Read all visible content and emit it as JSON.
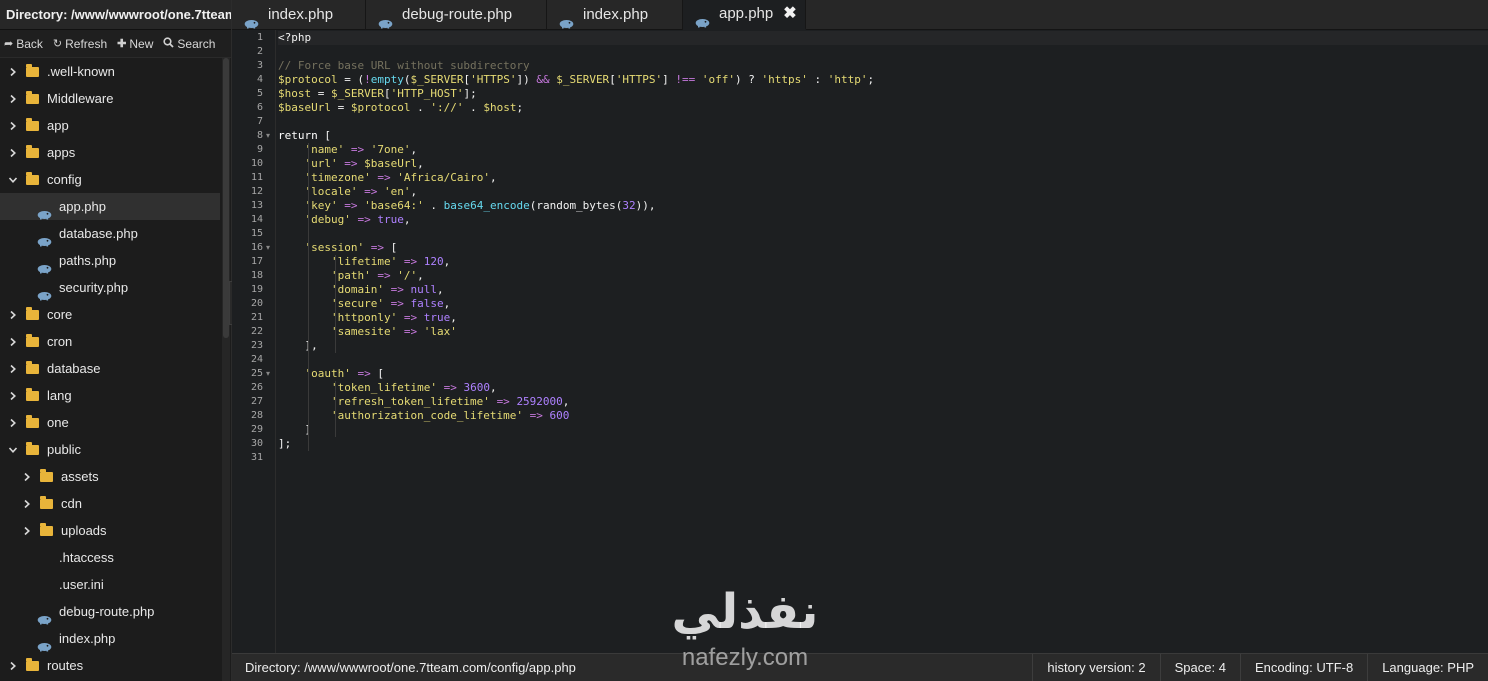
{
  "sidebar": {
    "title": "Directory: /www/wwwroot/one.7tteam....",
    "toolbar": {
      "back": "Back",
      "refresh": "Refresh",
      "new": "New",
      "search": "Search"
    },
    "tree": [
      {
        "label": ".well-known",
        "type": "folder",
        "depth": 0,
        "expanded": false
      },
      {
        "label": "Middleware",
        "type": "folder",
        "depth": 0,
        "expanded": false
      },
      {
        "label": "app",
        "type": "folder",
        "depth": 0,
        "expanded": false
      },
      {
        "label": "apps",
        "type": "folder",
        "depth": 0,
        "expanded": false
      },
      {
        "label": "config",
        "type": "folder",
        "depth": 0,
        "expanded": true
      },
      {
        "label": "app.php",
        "type": "php",
        "depth": 1,
        "selected": true
      },
      {
        "label": "database.php",
        "type": "php",
        "depth": 1
      },
      {
        "label": "paths.php",
        "type": "php",
        "depth": 1
      },
      {
        "label": "security.php",
        "type": "php",
        "depth": 1
      },
      {
        "label": "core",
        "type": "folder",
        "depth": 0,
        "expanded": false
      },
      {
        "label": "cron",
        "type": "folder",
        "depth": 0,
        "expanded": false
      },
      {
        "label": "database",
        "type": "folder",
        "depth": 0,
        "expanded": false
      },
      {
        "label": "lang",
        "type": "folder",
        "depth": 0,
        "expanded": false
      },
      {
        "label": "one",
        "type": "folder",
        "depth": 0,
        "expanded": false
      },
      {
        "label": "public",
        "type": "folder",
        "depth": 0,
        "expanded": true
      },
      {
        "label": "assets",
        "type": "folder",
        "depth": 1,
        "expanded": false
      },
      {
        "label": "cdn",
        "type": "folder",
        "depth": 1,
        "expanded": false
      },
      {
        "label": "uploads",
        "type": "folder",
        "depth": 1,
        "expanded": false
      },
      {
        "label": ".htaccess",
        "type": "file",
        "depth": 1
      },
      {
        "label": ".user.ini",
        "type": "file",
        "depth": 1
      },
      {
        "label": "debug-route.php",
        "type": "php",
        "depth": 1
      },
      {
        "label": "index.php",
        "type": "php",
        "depth": 1
      },
      {
        "label": "routes",
        "type": "folder",
        "depth": 0,
        "expanded": false
      }
    ]
  },
  "tabs": [
    {
      "label": "index.php",
      "active": false
    },
    {
      "label": "debug-route.php",
      "active": false
    },
    {
      "label": "index.php",
      "active": false
    },
    {
      "label": "app.php",
      "active": true,
      "close": "✖"
    }
  ],
  "editor": {
    "lines": [
      [
        [
          "p",
          "<?php"
        ]
      ],
      [],
      [
        [
          "cmt",
          "// Force base URL without subdirectory"
        ]
      ],
      [
        [
          "var",
          "$protocol"
        ],
        [
          "p",
          " = ("
        ],
        [
          "op",
          "!"
        ],
        [
          "fn",
          "empty"
        ],
        [
          "p",
          "("
        ],
        [
          "var",
          "$_SERVER"
        ],
        [
          "p",
          "["
        ],
        [
          "str",
          "'HTTPS'"
        ],
        [
          "p",
          "]) "
        ],
        [
          "op",
          "&&"
        ],
        [
          "p",
          " "
        ],
        [
          "var",
          "$_SERVER"
        ],
        [
          "p",
          "["
        ],
        [
          "str",
          "'HTTPS'"
        ],
        [
          "p",
          "] "
        ],
        [
          "op",
          "!=="
        ],
        [
          "p",
          " "
        ],
        [
          "str",
          "'off'"
        ],
        [
          "p",
          ") ? "
        ],
        [
          "str",
          "'https'"
        ],
        [
          "p",
          " : "
        ],
        [
          "str",
          "'http'"
        ],
        [
          "p",
          ";"
        ]
      ],
      [
        [
          "var",
          "$host"
        ],
        [
          "p",
          " = "
        ],
        [
          "var",
          "$_SERVER"
        ],
        [
          "p",
          "["
        ],
        [
          "str",
          "'HTTP_HOST'"
        ],
        [
          "p",
          "];"
        ]
      ],
      [
        [
          "var",
          "$baseUrl"
        ],
        [
          "p",
          " = "
        ],
        [
          "var",
          "$protocol"
        ],
        [
          "p",
          " . "
        ],
        [
          "str",
          "'://'"
        ],
        [
          "p",
          " . "
        ],
        [
          "var",
          "$host"
        ],
        [
          "p",
          ";"
        ]
      ],
      [],
      [
        [
          "kw",
          "return"
        ],
        [
          "p",
          " ["
        ]
      ],
      [
        [
          "p",
          "    "
        ],
        [
          "str",
          "'name'"
        ],
        [
          "p",
          " "
        ],
        [
          "op",
          "=>"
        ],
        [
          "p",
          " "
        ],
        [
          "str",
          "'7one'"
        ],
        [
          "p",
          ","
        ]
      ],
      [
        [
          "p",
          "    "
        ],
        [
          "str",
          "'url'"
        ],
        [
          "p",
          " "
        ],
        [
          "op",
          "=>"
        ],
        [
          "p",
          " "
        ],
        [
          "var",
          "$baseUrl"
        ],
        [
          "p",
          ","
        ]
      ],
      [
        [
          "p",
          "    "
        ],
        [
          "str",
          "'timezone'"
        ],
        [
          "p",
          " "
        ],
        [
          "op",
          "=>"
        ],
        [
          "p",
          " "
        ],
        [
          "str",
          "'Africa/Cairo'"
        ],
        [
          "p",
          ","
        ]
      ],
      [
        [
          "p",
          "    "
        ],
        [
          "str",
          "'locale'"
        ],
        [
          "p",
          " "
        ],
        [
          "op",
          "=>"
        ],
        [
          "p",
          " "
        ],
        [
          "str",
          "'en'"
        ],
        [
          "p",
          ","
        ]
      ],
      [
        [
          "p",
          "    "
        ],
        [
          "str",
          "'key'"
        ],
        [
          "p",
          " "
        ],
        [
          "op",
          "=>"
        ],
        [
          "p",
          " "
        ],
        [
          "str",
          "'base64:'"
        ],
        [
          "p",
          " . "
        ],
        [
          "fn",
          "base64_encode"
        ],
        [
          "p",
          "(random_bytes("
        ],
        [
          "num",
          "32"
        ],
        [
          "p",
          ")),"
        ]
      ],
      [
        [
          "p",
          "    "
        ],
        [
          "str",
          "'debug'"
        ],
        [
          "p",
          " "
        ],
        [
          "op",
          "=>"
        ],
        [
          "p",
          " "
        ],
        [
          "bool",
          "true"
        ],
        [
          "p",
          ","
        ]
      ],
      [],
      [
        [
          "p",
          "    "
        ],
        [
          "str",
          "'session'"
        ],
        [
          "p",
          " "
        ],
        [
          "op",
          "=>"
        ],
        [
          "p",
          " ["
        ]
      ],
      [
        [
          "p",
          "        "
        ],
        [
          "str",
          "'lifetime'"
        ],
        [
          "p",
          " "
        ],
        [
          "op",
          "=>"
        ],
        [
          "p",
          " "
        ],
        [
          "num",
          "120"
        ],
        [
          "p",
          ","
        ]
      ],
      [
        [
          "p",
          "        "
        ],
        [
          "str",
          "'path'"
        ],
        [
          "p",
          " "
        ],
        [
          "op",
          "=>"
        ],
        [
          "p",
          " "
        ],
        [
          "str",
          "'/'"
        ],
        [
          "p",
          ","
        ]
      ],
      [
        [
          "p",
          "        "
        ],
        [
          "str",
          "'domain'"
        ],
        [
          "p",
          " "
        ],
        [
          "op",
          "=>"
        ],
        [
          "p",
          " "
        ],
        [
          "bool",
          "null"
        ],
        [
          "p",
          ","
        ]
      ],
      [
        [
          "p",
          "        "
        ],
        [
          "str",
          "'secure'"
        ],
        [
          "p",
          " "
        ],
        [
          "op",
          "=>"
        ],
        [
          "p",
          " "
        ],
        [
          "bool",
          "false"
        ],
        [
          "p",
          ","
        ]
      ],
      [
        [
          "p",
          "        "
        ],
        [
          "str",
          "'httponly'"
        ],
        [
          "p",
          " "
        ],
        [
          "op",
          "=>"
        ],
        [
          "p",
          " "
        ],
        [
          "bool",
          "true"
        ],
        [
          "p",
          ","
        ]
      ],
      [
        [
          "p",
          "        "
        ],
        [
          "str",
          "'samesite'"
        ],
        [
          "p",
          " "
        ],
        [
          "op",
          "=>"
        ],
        [
          "p",
          " "
        ],
        [
          "str",
          "'lax'"
        ]
      ],
      [
        [
          "p",
          "    ],"
        ]
      ],
      [],
      [
        [
          "p",
          "    "
        ],
        [
          "str",
          "'oauth'"
        ],
        [
          "p",
          " "
        ],
        [
          "op",
          "=>"
        ],
        [
          "p",
          " ["
        ]
      ],
      [
        [
          "p",
          "        "
        ],
        [
          "str",
          "'token_lifetime'"
        ],
        [
          "p",
          " "
        ],
        [
          "op",
          "=>"
        ],
        [
          "p",
          " "
        ],
        [
          "num",
          "3600"
        ],
        [
          "p",
          ","
        ]
      ],
      [
        [
          "p",
          "        "
        ],
        [
          "str",
          "'refresh_token_lifetime'"
        ],
        [
          "p",
          " "
        ],
        [
          "op",
          "=>"
        ],
        [
          "p",
          " "
        ],
        [
          "num",
          "2592000"
        ],
        [
          "p",
          ","
        ]
      ],
      [
        [
          "p",
          "        "
        ],
        [
          "str",
          "'authorization_code_lifetime'"
        ],
        [
          "p",
          " "
        ],
        [
          "op",
          "=>"
        ],
        [
          "p",
          " "
        ],
        [
          "num",
          "600"
        ]
      ],
      [
        [
          "p",
          "    ]"
        ]
      ],
      [
        [
          "p",
          "];"
        ]
      ],
      []
    ],
    "foldable_lines": [
      8,
      16,
      25
    ]
  },
  "statusbar": {
    "directory": "Directory: /www/wwwroot/one.7tteam.com/config/app.php",
    "history": "history version: 2",
    "space": "Space: 4",
    "encoding": "Encoding: UTF-8",
    "language": "Language: PHP"
  },
  "watermark": {
    "arabic": "نفذلي",
    "latin": "nafezly.com"
  },
  "colors": {
    "folder": "#e8b43a",
    "php_icon": "#7aa3c8",
    "string": "#e6db74",
    "operator": "#c678dd",
    "number": "#ae81ff",
    "function": "#66d9ef",
    "comment": "#75715e"
  }
}
